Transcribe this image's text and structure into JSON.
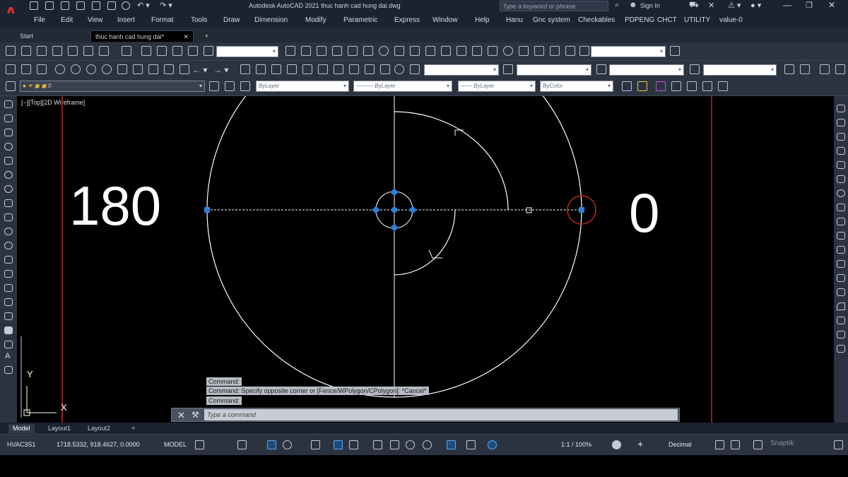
{
  "titlebar": {
    "title": "Autodesk AutoCAD 2021   thuc hanh cad hung dai.dwg",
    "search_placeholder": "Type a keyword or phrase",
    "sign_in": "Sign In"
  },
  "menu": [
    "File",
    "Edit",
    "View",
    "Insert",
    "Format",
    "Tools",
    "Draw",
    "Dimension",
    "Modify",
    "Parametric",
    "Express",
    "Window",
    "Help",
    "Hanu",
    "Gnc system",
    "Checkables",
    "PDPENG",
    "CHCT",
    "UTILITY",
    "value-0"
  ],
  "tabs": {
    "start": "Start",
    "active": "thuc hanh cad hung dai*",
    "add": "+"
  },
  "toolbar": {
    "layer_value": "0",
    "color_value": "ByLayer",
    "linetype_value": "ByLayer",
    "lineweight_value": "ByLayer",
    "plotstyle_value": "ByColor"
  },
  "viewport": {
    "label": "[−][Top][2D Wireframe]",
    "angle_left": "180",
    "angle_right": "0",
    "ucs_y": "Y",
    "ucs_x": "X"
  },
  "command": {
    "history": [
      "Command:",
      "Command: Specify opposite corner or [Fence/WPolygon/CPolygon]: *Cancel*",
      "Command:"
    ],
    "placeholder": "Type a command",
    "close": "✕",
    "custom": "⚒"
  },
  "layout_tabs": [
    "Model",
    "Layout1",
    "Layout2"
  ],
  "layout_add": "+",
  "status": {
    "style": "HVAC3S1",
    "coordinates": "1718.5332, 918.4627, 0.0000",
    "model": "MODEL",
    "scale": "1:1 / 100%",
    "units": "Decimal",
    "watermark": "Snaptik"
  },
  "colors": {
    "accent": "#2f7fd6",
    "grip": "#2f7fd6",
    "boundary": "#c0281c",
    "geometry": "#ffffff"
  }
}
